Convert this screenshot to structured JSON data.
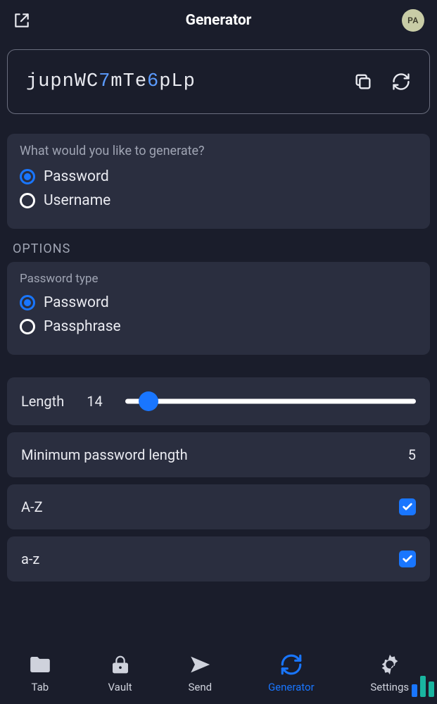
{
  "header": {
    "title": "Generator",
    "avatar_initials": "PA"
  },
  "generated": {
    "segments": [
      {
        "t": "jupnWC",
        "d": false
      },
      {
        "t": "7",
        "d": true
      },
      {
        "t": "mTe",
        "d": false
      },
      {
        "t": "6",
        "d": true
      },
      {
        "t": "pLp",
        "d": false
      }
    ]
  },
  "generate_type": {
    "question": "What would you like to generate?",
    "options": [
      {
        "label": "Password",
        "selected": true
      },
      {
        "label": "Username",
        "selected": false
      }
    ]
  },
  "options_heading": "OPTIONS",
  "password_type": {
    "label": "Password type",
    "options": [
      {
        "label": "Password",
        "selected": true
      },
      {
        "label": "Passphrase",
        "selected": false
      }
    ]
  },
  "length": {
    "label": "Length",
    "value": "14",
    "thumb_pct": 8
  },
  "min_length": {
    "label": "Minimum password length",
    "value": "5"
  },
  "charset": [
    {
      "label": "A-Z",
      "checked": true
    },
    {
      "label": "a-z",
      "checked": true
    }
  ],
  "nav": {
    "items": [
      {
        "key": "tab",
        "label": "Tab"
      },
      {
        "key": "vault",
        "label": "Vault"
      },
      {
        "key": "send",
        "label": "Send"
      },
      {
        "key": "generator",
        "label": "Generator",
        "active": true
      },
      {
        "key": "settings",
        "label": "Settings"
      }
    ]
  }
}
